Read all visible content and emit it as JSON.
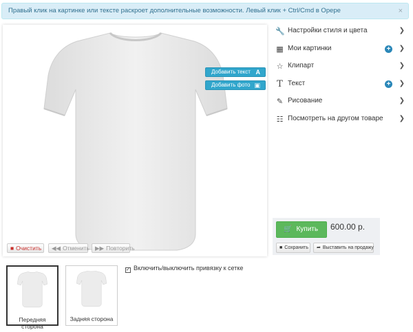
{
  "alert": {
    "text": "Правый клик на картинке или тексте раскроет дополнительные возможности. Левый клик + Ctrl/Cmd в Opepe",
    "close": "×"
  },
  "canvas": {
    "add_text": "Добавить текст",
    "add_text_icon": "A",
    "add_photo": "Добавить фото",
    "clear": "Очистить",
    "undo": "Отменить",
    "redo": "Повторить"
  },
  "menu": {
    "items": [
      {
        "label": "Настройки стиля и цвета",
        "icon": "wrench-icon"
      },
      {
        "label": "Мои картинки",
        "icon": "image-icon",
        "plus": true
      },
      {
        "label": "Клипарт",
        "icon": "star-icon"
      },
      {
        "label": "Текст",
        "icon": "text-icon",
        "plus": true
      },
      {
        "label": "Рисование",
        "icon": "pencil-icon"
      },
      {
        "label": "Посмотреть на другом товаре",
        "icon": "products-icon"
      }
    ]
  },
  "buy": {
    "label": "Купить",
    "price": "600.00 р.",
    "save": "Сохранить",
    "sell": "Выставить на продажу"
  },
  "grid_toggle": {
    "label": "Включить/выключить привязку к сетке",
    "checked": true
  },
  "sides": [
    {
      "label": "Передняя сторона",
      "selected": true
    },
    {
      "label": "Задняя сторона",
      "selected": false
    }
  ],
  "colors": {
    "accent": "#31a6cc",
    "buy": "#5cb85c",
    "danger": "#c9302c",
    "alert_bg": "#d9edf7"
  }
}
